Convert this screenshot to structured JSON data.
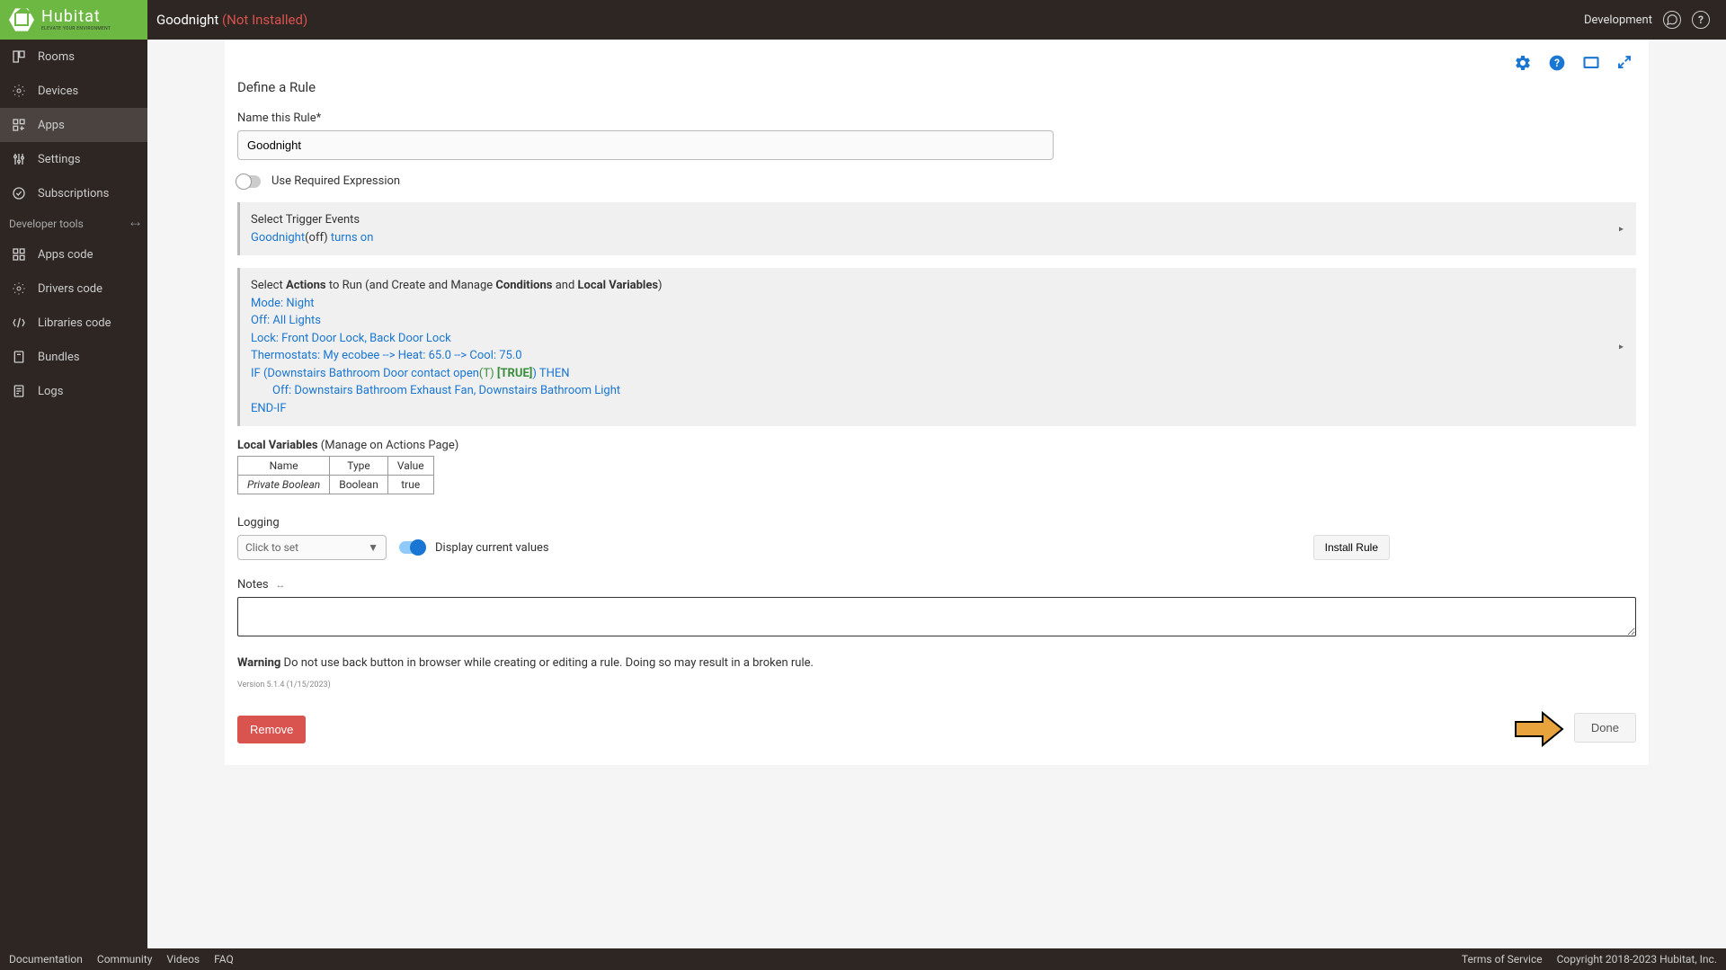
{
  "header": {
    "logo_main": "Hubitat",
    "logo_sub": "ELEVATE YOUR ENVIRONMENT",
    "title": "Goodnight",
    "status": "(Not Installed)",
    "dev_label": "Development"
  },
  "sidebar": {
    "items": [
      {
        "label": "Rooms",
        "icon": "rooms"
      },
      {
        "label": "Devices",
        "icon": "devices"
      },
      {
        "label": "Apps",
        "icon": "apps",
        "active": true
      },
      {
        "label": "Settings",
        "icon": "settings"
      },
      {
        "label": "Subscriptions",
        "icon": "subscriptions"
      }
    ],
    "dev_section": "Developer tools",
    "dev_items": [
      {
        "label": "Apps code",
        "icon": "apps-code"
      },
      {
        "label": "Drivers code",
        "icon": "drivers-code"
      },
      {
        "label": "Libraries code",
        "icon": "libraries-code"
      },
      {
        "label": "Bundles",
        "icon": "bundles"
      },
      {
        "label": "Logs",
        "icon": "logs"
      }
    ]
  },
  "main": {
    "section_title": "Define a Rule",
    "name_label": "Name this Rule*",
    "name_value": "Goodnight",
    "use_required": "Use Required Expression",
    "triggers": {
      "title": "Select Trigger Events",
      "line1_a": "Goodnight",
      "line1_b": "(off)",
      "line1_c": " turns on"
    },
    "actions": {
      "prefix": "Select ",
      "bold1": "Actions",
      "mid1": " to Run (and Create and Manage ",
      "bold2": "Conditions",
      "mid2": " and ",
      "bold3": "Local Variables",
      "suffix": ")",
      "l1": "Mode: Night",
      "l2": "Off: All Lights",
      "l3": "Lock: Front Door Lock, Back Door Lock",
      "l4": "Thermostats: My ecobee --> Heat: 65.0 --> Cool: 75.0",
      "l5a": "IF (Downstairs Bathroom Door contact open",
      "l5b": "(T)",
      "l5c": " [TRUE]",
      "l5d": ") THEN",
      "l6": "Off: Downstairs Bathroom Exhaust Fan, Downstairs Bathroom Light",
      "l7": "END-IF"
    },
    "local_vars": {
      "title": "Local Variables",
      "subtitle": " (Manage on Actions Page)",
      "headers": [
        "Name",
        "Type",
        "Value"
      ],
      "row": [
        "Private Boolean",
        "Boolean",
        "true"
      ]
    },
    "logging_label": "Logging",
    "logging_placeholder": "Click to set",
    "display_current": "Display current values",
    "install_btn": "Install Rule",
    "notes_label": "Notes",
    "warning_bold": "Warning",
    "warning_text": " Do not use back button in browser while creating or editing a rule. Doing so may result in a broken rule.",
    "version": "Version 5.1.4 (1/15/2023)",
    "remove_btn": "Remove",
    "done_btn": "Done"
  },
  "footer": {
    "left": [
      "Documentation",
      "Community",
      "Videos",
      "FAQ"
    ],
    "right": [
      "Terms of Service",
      "Copyright 2018-2023 Hubitat, Inc."
    ]
  }
}
